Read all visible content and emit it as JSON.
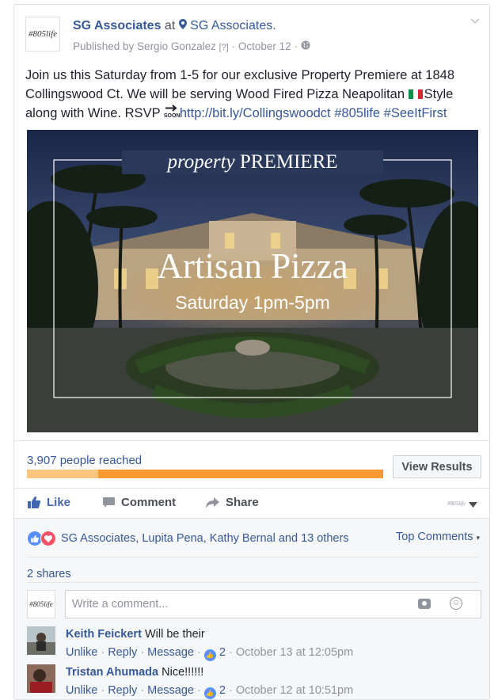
{
  "post": {
    "avatar_text": "#805life",
    "page_name": "SG Associates",
    "at": "at",
    "location": "SG Associates.",
    "published_by": "Published by Sergio Gonzalez",
    "help_mark": "[?]",
    "sep": "·",
    "date": "October 12",
    "text_line1": "Join us this Saturday from 1-5 for our exclusive Property Premiere at 1848",
    "text_line2": "Collingswood Ct. We will be serving Wood Fired Pizza Neapolitan",
    "text_line2_end": "Style",
    "text_line3": "along with Wine. RSVP",
    "soon_label": "SOON",
    "link": "http://bit.ly/Collingswoodct",
    "hashtag1": "#805life",
    "hashtag2": "#SeeItFirst"
  },
  "photo": {
    "script_word": "property",
    "caps_word": "PREMIERE",
    "headline": "Artisan Pizza",
    "subline": "Saturday 1pm-5pm"
  },
  "stats": {
    "reached": "3,907 people reached",
    "reach_fill_fraction": 0.2,
    "view_results": "View Results"
  },
  "actions": {
    "like": "Like",
    "comment": "Comment",
    "share": "Share",
    "menu_icon_text": "#805life"
  },
  "reactions": {
    "summary": "SG Associates, Lupita Pena, Kathy Bernal and 13 others",
    "top_comments": "Top Comments"
  },
  "shares": "2 shares",
  "composer": {
    "avatar_text": "#805life",
    "placeholder": "Write a comment..."
  },
  "comments": [
    {
      "name": "Keith Feickert",
      "text": "Will be their",
      "unlike": "Unlike",
      "reply": "Reply",
      "message": "Message",
      "likes": "2",
      "time": "October 13 at 12:05pm"
    },
    {
      "name": "Tristan Ahumada",
      "text": "Nice!!!!!!",
      "unlike": "Unlike",
      "reply": "Reply",
      "message": "Message",
      "likes": "2",
      "time": "October 12 at 10:51pm"
    }
  ],
  "colors": {
    "link": "#365899",
    "progress": "#f79a31",
    "progress_light": "#fbc57c",
    "like_blue": "#4267b2"
  }
}
